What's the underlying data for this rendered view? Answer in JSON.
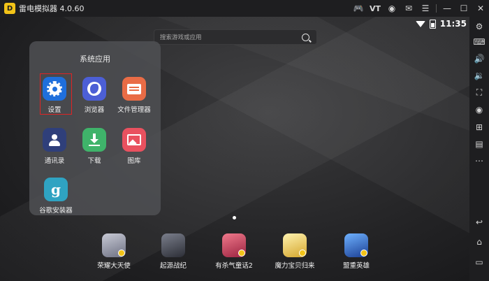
{
  "window": {
    "title": "雷电模拟器 4.0.60",
    "logo_text": "D",
    "title_icons": [
      {
        "name": "gamepad-icon",
        "glyph": "🎮"
      },
      {
        "name": "vt-badge",
        "glyph": "VT"
      },
      {
        "name": "user-icon",
        "glyph": "◉"
      },
      {
        "name": "mail-icon",
        "glyph": "✉"
      },
      {
        "name": "menu-icon",
        "glyph": "☰"
      },
      {
        "name": "minimize-icon",
        "glyph": "—"
      },
      {
        "name": "maximize-icon",
        "glyph": "☐"
      },
      {
        "name": "close-icon",
        "glyph": "✕"
      }
    ]
  },
  "status_bar": {
    "time": "11:35"
  },
  "search": {
    "placeholder": "搜索游戏或应用"
  },
  "folder": {
    "title": "系统应用",
    "apps": [
      {
        "label": "设置",
        "color": "#1f6fdc",
        "icon": "gear-icon",
        "selected": true
      },
      {
        "label": "浏览器",
        "color": "#4c5fd6",
        "icon": "globe-icon"
      },
      {
        "label": "文件管理器",
        "color": "#e96c46",
        "icon": "folder-icon"
      },
      {
        "label": "通讯录",
        "color": "#2f3f7a",
        "icon": "contact-icon"
      },
      {
        "label": "下载",
        "color": "#3fb36a",
        "icon": "download-icon"
      },
      {
        "label": "图库",
        "color": "#e9515f",
        "icon": "gallery-icon"
      },
      {
        "label": "谷歌安装器",
        "color": "#2fa3c2",
        "icon": "google-installer-icon",
        "glyph": "g"
      }
    ]
  },
  "dock": [
    {
      "label": "荣耀大天使",
      "color": "#8a8fa6",
      "icon": "angel-game-icon"
    },
    {
      "label": "起源战纪",
      "color": "#4a4e5c",
      "icon": "origin-game-icon"
    },
    {
      "label": "有杀气童话2",
      "color": "#c43d55",
      "icon": "fairy-tale-game-icon"
    },
    {
      "label": "魔力宝贝归来",
      "color": "#e7c84a",
      "icon": "crossgate-game-icon"
    },
    {
      "label": "盟重英雄",
      "color": "#2a66c9",
      "icon": "mengzhong-game-icon"
    }
  ],
  "right_toolbar": [
    {
      "name": "settings-gear-icon",
      "glyph": "⚙"
    },
    {
      "name": "keyboard-icon",
      "glyph": "⌨"
    },
    {
      "name": "volume-up-icon",
      "glyph": "🔊"
    },
    {
      "name": "volume-down-icon",
      "glyph": "🔉"
    },
    {
      "name": "fullscreen-icon",
      "glyph": "⛶"
    },
    {
      "name": "record-icon",
      "glyph": "◉"
    },
    {
      "name": "add-apk-icon",
      "glyph": "⊞"
    },
    {
      "name": "apk-install-icon",
      "glyph": "▤"
    },
    {
      "name": "more-icon",
      "glyph": "⋯"
    },
    {
      "name": "back-icon",
      "glyph": "↩"
    },
    {
      "name": "home-icon",
      "glyph": "⌂"
    },
    {
      "name": "recent-apps-icon",
      "glyph": "▭"
    }
  ]
}
